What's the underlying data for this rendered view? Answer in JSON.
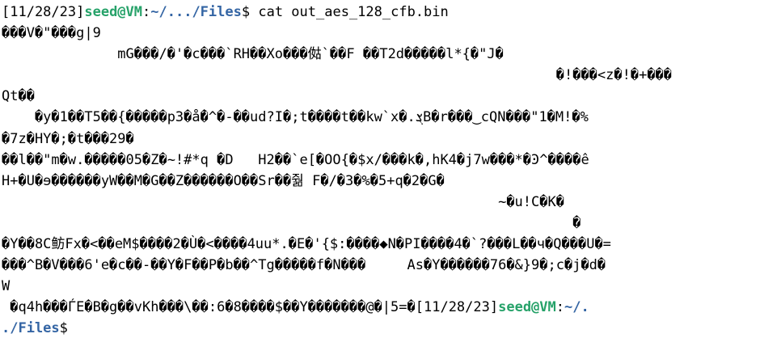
{
  "prompt": {
    "timestamp": "[11/28/23]",
    "user_host": "seed@VM",
    "colon": ":",
    "path": "~/.../Files",
    "dollar": "$ ",
    "command": "cat out_aes_128_cfb.bin"
  },
  "output_lines": [
    "���V�\"���g|9",
    "              mG���/�'�c���`RH��Xo���㑬`��F ��T2d�����l*{�\"J�",
    "                                                                   �!���<z�!�+���",
    "Qt��",
    "    �y�1��T5��{�����p3�ǻ�^�-��ud?I�;t����t��kw`x�.ܮB�r���‿cQN���\"1�M!�%",
    "�7z�HY�;�t���29�",
    "��l��\"m�w.�����05�Z�~!#*q �D   H2��`e[�OO{�$x/���k�,hK4�j7w���*�Ͽ^����ê",
    "H+�U�ɘ������yW��M�G��Z������O��Sr��줢 F�/�3�%�5+q�2�G�",
    "                                                            ~�u!C�K�",
    "                                                                     �",
    "�Y��8C鲂Fx�<��eM$����2�Ù�<����4uu*.�E�'{$:����◆N�PI����4�`?���L��ч�Q���U�=",
    "���^B�V���6'e�c��-��Y�F��P�b��^Tg�����f�N���     As�Y������76�&}9�;c�j�d�",
    "W"
  ],
  "last_line": {
    "text": " �q4h���ЃE�B�g��vKh���\\��:6�8����$��Y�������@�|5=�",
    "timestamp": "[11/28/23]",
    "user_host": "seed@VM",
    "colon": ":",
    "path_part1": "~/.",
    "path_part2": "./Files",
    "dollar": "$"
  }
}
